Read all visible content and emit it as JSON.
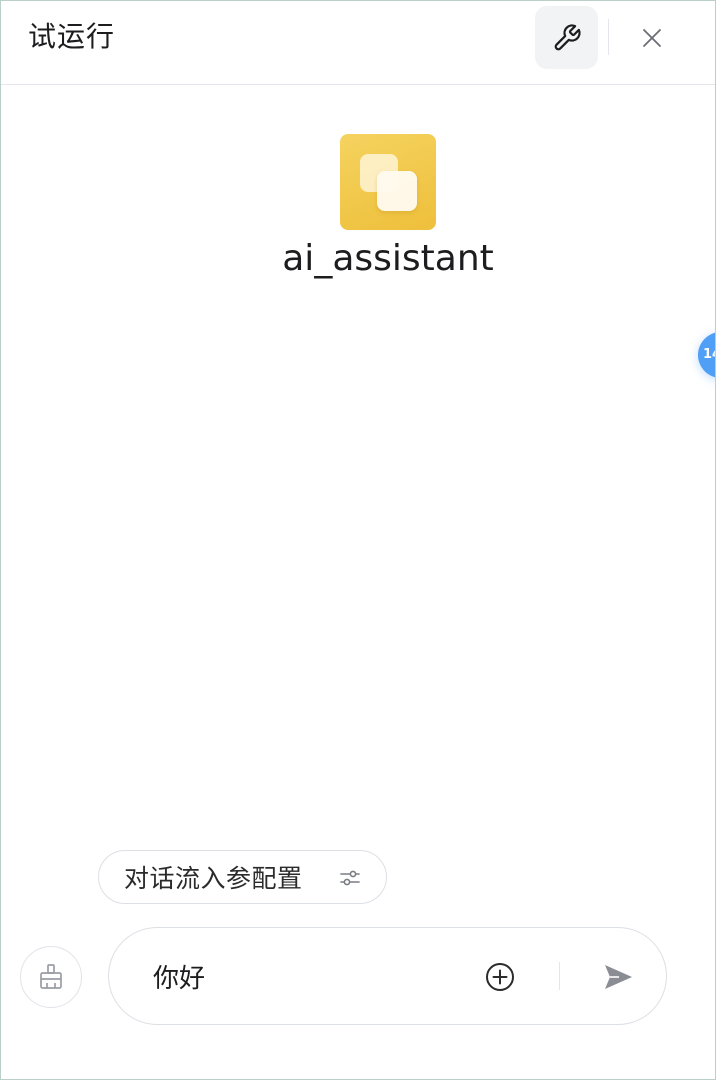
{
  "header": {
    "title": "试运行",
    "tool_icon": "wrench-icon",
    "close_icon": "close-icon"
  },
  "bot": {
    "name": "ai_assistant",
    "avatar_icon": "layered-squares-icon",
    "avatar_color": "#f2c94c"
  },
  "side_badge": {
    "text": "14",
    "color": "#4e9ff5"
  },
  "params_chip": {
    "label": "对话流入参配置",
    "icon": "sliders-icon"
  },
  "composer": {
    "clear_icon": "broom-icon",
    "input_value": "你好",
    "add_icon": "plus-circle-icon",
    "send_icon": "send-icon"
  }
}
